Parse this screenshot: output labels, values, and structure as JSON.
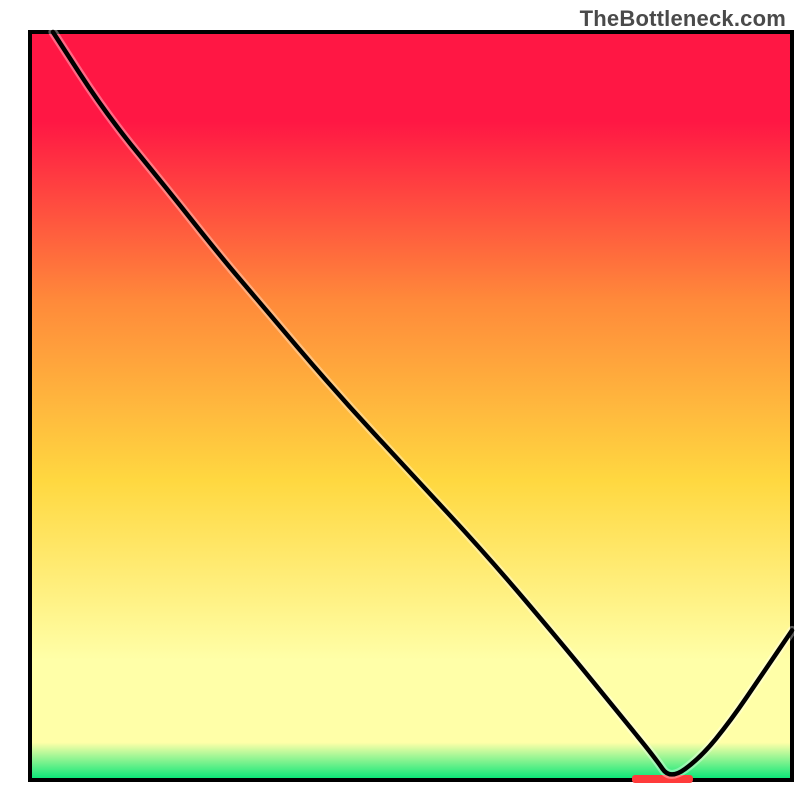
{
  "watermark": {
    "text": "TheBottleneck.com"
  },
  "colors": {
    "top": "#ff1744",
    "mid1": "#ff8a3a",
    "mid2": "#ffd840",
    "mid3": "#ffffa8",
    "bottom": "#00e676",
    "plot_black": "#000000",
    "plot_white": "#ffffff",
    "marker_red": "#ff3b3b"
  },
  "chart_data": {
    "type": "line",
    "title": "",
    "xlabel": "",
    "ylabel": "",
    "xlim": [
      0,
      100
    ],
    "ylim": [
      0,
      100
    ],
    "grid": false,
    "legend": false,
    "x": [
      3,
      10,
      18,
      25,
      30,
      40,
      50,
      60,
      70,
      78,
      82,
      84,
      88,
      92,
      96,
      100
    ],
    "values": [
      100,
      89,
      79,
      70,
      64,
      52,
      41,
      30,
      18,
      8,
      3,
      0,
      3,
      8,
      14,
      20
    ],
    "marker": {
      "x_range": [
        79,
        87
      ],
      "y": 0
    },
    "gradient_stops": [
      {
        "pos": 0.0,
        "k": "top"
      },
      {
        "pos": 0.12,
        "k": "top"
      },
      {
        "pos": 0.36,
        "k": "mid1"
      },
      {
        "pos": 0.6,
        "k": "mid2"
      },
      {
        "pos": 0.84,
        "k": "mid3"
      },
      {
        "pos": 0.95,
        "k": "mid3"
      },
      {
        "pos": 1.0,
        "k": "bottom"
      }
    ]
  }
}
